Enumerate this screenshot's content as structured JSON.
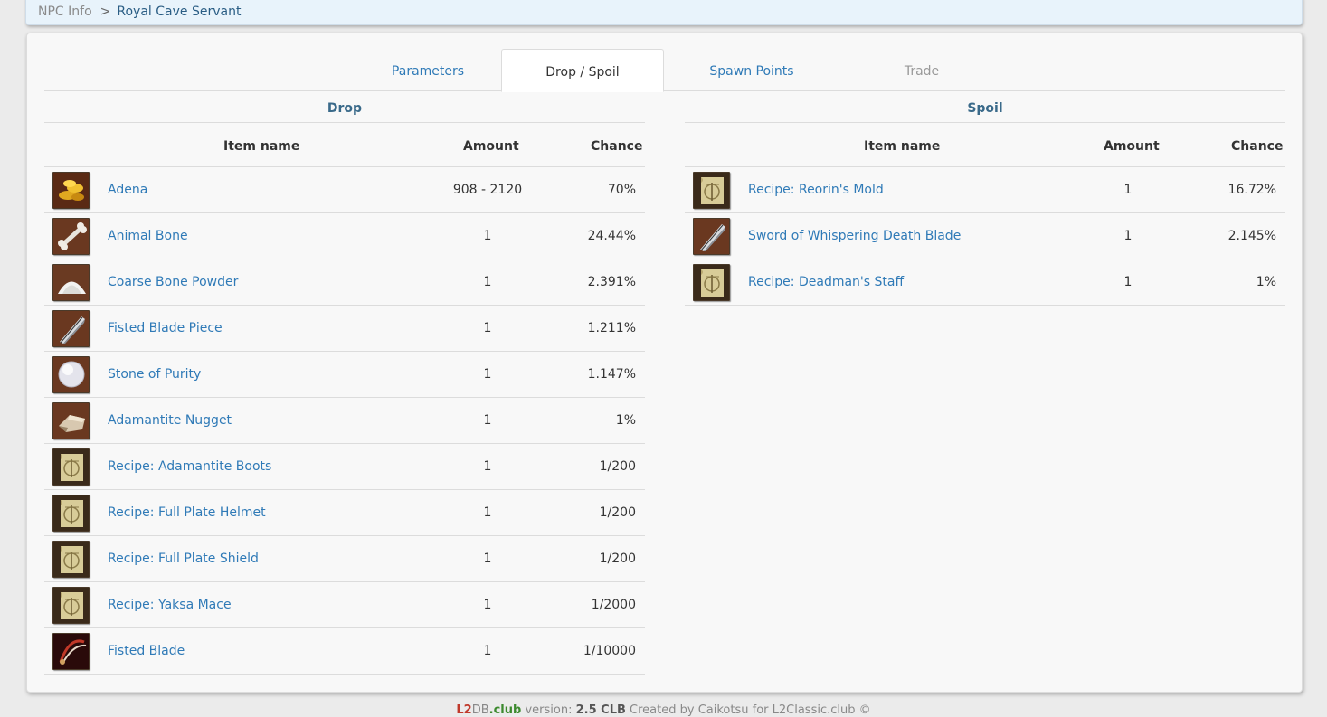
{
  "breadcrumb": {
    "root": "NPC Info",
    "separator": ">",
    "current": "Royal Cave Servant"
  },
  "tabs": [
    {
      "label": "Parameters"
    },
    {
      "label": "Drop / Spoil"
    },
    {
      "label": "Spawn Points"
    },
    {
      "label": "Trade"
    }
  ],
  "drop": {
    "title": "Drop",
    "headers": {
      "name": "Item name",
      "amount": "Amount",
      "chance": "Chance"
    },
    "rows": [
      {
        "name": "Adena",
        "amount": "908 - 2120",
        "chance": "70%",
        "icon": "adena-icon"
      },
      {
        "name": "Animal Bone",
        "amount": "1",
        "chance": "24.44%",
        "icon": "bone-icon"
      },
      {
        "name": "Coarse Bone Powder",
        "amount": "1",
        "chance": "2.391%",
        "icon": "powder-icon"
      },
      {
        "name": "Fisted Blade Piece",
        "amount": "1",
        "chance": "1.211%",
        "icon": "blade-icon"
      },
      {
        "name": "Stone of Purity",
        "amount": "1",
        "chance": "1.147%",
        "icon": "stone-icon"
      },
      {
        "name": "Adamantite Nugget",
        "amount": "1",
        "chance": "1%",
        "icon": "nugget-icon"
      },
      {
        "name": "Recipe: Adamantite Boots",
        "amount": "1",
        "chance": "1/200",
        "icon": "recipe-icon"
      },
      {
        "name": "Recipe: Full Plate Helmet",
        "amount": "1",
        "chance": "1/200",
        "icon": "recipe-icon"
      },
      {
        "name": "Recipe: Full Plate Shield",
        "amount": "1",
        "chance": "1/200",
        "icon": "recipe-icon"
      },
      {
        "name": "Recipe: Yaksa Mace",
        "amount": "1",
        "chance": "1/2000",
        "icon": "recipe-icon"
      },
      {
        "name": "Fisted Blade",
        "amount": "1",
        "chance": "1/10000",
        "icon": "fisted-blade-icon"
      }
    ]
  },
  "spoil": {
    "title": "Spoil",
    "headers": {
      "name": "Item name",
      "amount": "Amount",
      "chance": "Chance"
    },
    "rows": [
      {
        "name": "Recipe: Reorin's Mold",
        "amount": "1",
        "chance": "16.72%",
        "icon": "recipe-icon"
      },
      {
        "name": "Sword of Whispering Death Blade",
        "amount": "1",
        "chance": "2.145%",
        "icon": "blade-icon"
      },
      {
        "name": "Recipe: Deadman's Staff",
        "amount": "1",
        "chance": "1%",
        "icon": "recipe-icon"
      }
    ]
  },
  "footer": {
    "brand_l2": "L2",
    "brand_db": "DB",
    "brand_club": ".club",
    "version_label": "version:",
    "version": "2.5 CLB",
    "credit": "Created by Caikotsu for L2Classic.club ©"
  }
}
